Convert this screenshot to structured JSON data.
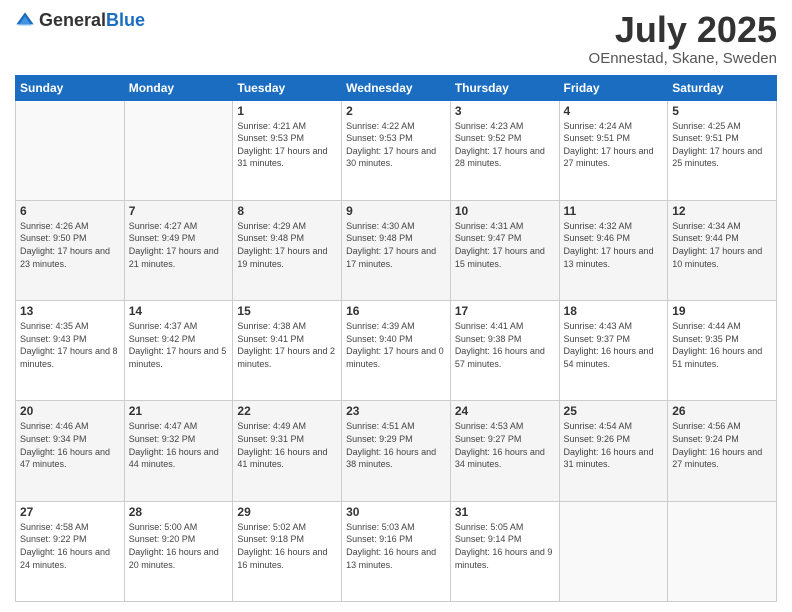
{
  "logo": {
    "text_general": "General",
    "text_blue": "Blue"
  },
  "header": {
    "month": "July 2025",
    "location": "OEnnestad, Skane, Sweden"
  },
  "weekdays": [
    "Sunday",
    "Monday",
    "Tuesday",
    "Wednesday",
    "Thursday",
    "Friday",
    "Saturday"
  ],
  "weeks": [
    [
      {
        "day": "",
        "info": ""
      },
      {
        "day": "",
        "info": ""
      },
      {
        "day": "1",
        "info": "Sunrise: 4:21 AM\nSunset: 9:53 PM\nDaylight: 17 hours and 31 minutes."
      },
      {
        "day": "2",
        "info": "Sunrise: 4:22 AM\nSunset: 9:53 PM\nDaylight: 17 hours and 30 minutes."
      },
      {
        "day": "3",
        "info": "Sunrise: 4:23 AM\nSunset: 9:52 PM\nDaylight: 17 hours and 28 minutes."
      },
      {
        "day": "4",
        "info": "Sunrise: 4:24 AM\nSunset: 9:51 PM\nDaylight: 17 hours and 27 minutes."
      },
      {
        "day": "5",
        "info": "Sunrise: 4:25 AM\nSunset: 9:51 PM\nDaylight: 17 hours and 25 minutes."
      }
    ],
    [
      {
        "day": "6",
        "info": "Sunrise: 4:26 AM\nSunset: 9:50 PM\nDaylight: 17 hours and 23 minutes."
      },
      {
        "day": "7",
        "info": "Sunrise: 4:27 AM\nSunset: 9:49 PM\nDaylight: 17 hours and 21 minutes."
      },
      {
        "day": "8",
        "info": "Sunrise: 4:29 AM\nSunset: 9:48 PM\nDaylight: 17 hours and 19 minutes."
      },
      {
        "day": "9",
        "info": "Sunrise: 4:30 AM\nSunset: 9:48 PM\nDaylight: 17 hours and 17 minutes."
      },
      {
        "day": "10",
        "info": "Sunrise: 4:31 AM\nSunset: 9:47 PM\nDaylight: 17 hours and 15 minutes."
      },
      {
        "day": "11",
        "info": "Sunrise: 4:32 AM\nSunset: 9:46 PM\nDaylight: 17 hours and 13 minutes."
      },
      {
        "day": "12",
        "info": "Sunrise: 4:34 AM\nSunset: 9:44 PM\nDaylight: 17 hours and 10 minutes."
      }
    ],
    [
      {
        "day": "13",
        "info": "Sunrise: 4:35 AM\nSunset: 9:43 PM\nDaylight: 17 hours and 8 minutes."
      },
      {
        "day": "14",
        "info": "Sunrise: 4:37 AM\nSunset: 9:42 PM\nDaylight: 17 hours and 5 minutes."
      },
      {
        "day": "15",
        "info": "Sunrise: 4:38 AM\nSunset: 9:41 PM\nDaylight: 17 hours and 2 minutes."
      },
      {
        "day": "16",
        "info": "Sunrise: 4:39 AM\nSunset: 9:40 PM\nDaylight: 17 hours and 0 minutes."
      },
      {
        "day": "17",
        "info": "Sunrise: 4:41 AM\nSunset: 9:38 PM\nDaylight: 16 hours and 57 minutes."
      },
      {
        "day": "18",
        "info": "Sunrise: 4:43 AM\nSunset: 9:37 PM\nDaylight: 16 hours and 54 minutes."
      },
      {
        "day": "19",
        "info": "Sunrise: 4:44 AM\nSunset: 9:35 PM\nDaylight: 16 hours and 51 minutes."
      }
    ],
    [
      {
        "day": "20",
        "info": "Sunrise: 4:46 AM\nSunset: 9:34 PM\nDaylight: 16 hours and 47 minutes."
      },
      {
        "day": "21",
        "info": "Sunrise: 4:47 AM\nSunset: 9:32 PM\nDaylight: 16 hours and 44 minutes."
      },
      {
        "day": "22",
        "info": "Sunrise: 4:49 AM\nSunset: 9:31 PM\nDaylight: 16 hours and 41 minutes."
      },
      {
        "day": "23",
        "info": "Sunrise: 4:51 AM\nSunset: 9:29 PM\nDaylight: 16 hours and 38 minutes."
      },
      {
        "day": "24",
        "info": "Sunrise: 4:53 AM\nSunset: 9:27 PM\nDaylight: 16 hours and 34 minutes."
      },
      {
        "day": "25",
        "info": "Sunrise: 4:54 AM\nSunset: 9:26 PM\nDaylight: 16 hours and 31 minutes."
      },
      {
        "day": "26",
        "info": "Sunrise: 4:56 AM\nSunset: 9:24 PM\nDaylight: 16 hours and 27 minutes."
      }
    ],
    [
      {
        "day": "27",
        "info": "Sunrise: 4:58 AM\nSunset: 9:22 PM\nDaylight: 16 hours and 24 minutes."
      },
      {
        "day": "28",
        "info": "Sunrise: 5:00 AM\nSunset: 9:20 PM\nDaylight: 16 hours and 20 minutes."
      },
      {
        "day": "29",
        "info": "Sunrise: 5:02 AM\nSunset: 9:18 PM\nDaylight: 16 hours and 16 minutes."
      },
      {
        "day": "30",
        "info": "Sunrise: 5:03 AM\nSunset: 9:16 PM\nDaylight: 16 hours and 13 minutes."
      },
      {
        "day": "31",
        "info": "Sunrise: 5:05 AM\nSunset: 9:14 PM\nDaylight: 16 hours and 9 minutes."
      },
      {
        "day": "",
        "info": ""
      },
      {
        "day": "",
        "info": ""
      }
    ]
  ]
}
